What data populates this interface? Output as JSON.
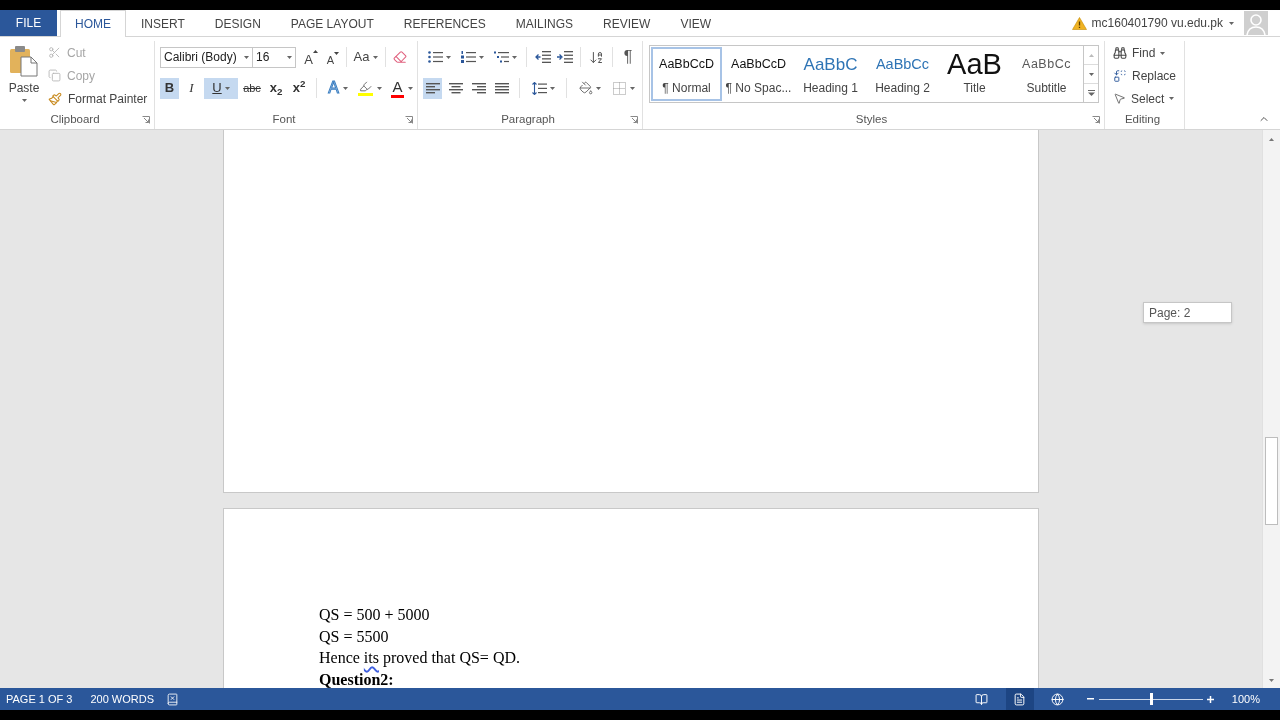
{
  "tabs": [
    {
      "label": "FILE",
      "kind": "file",
      "selected": false
    },
    {
      "label": "HOME",
      "kind": "tab",
      "selected": true
    },
    {
      "label": "INSERT",
      "kind": "tab",
      "selected": false
    },
    {
      "label": "DESIGN",
      "kind": "tab",
      "selected": false
    },
    {
      "label": "PAGE LAYOUT",
      "kind": "tab",
      "selected": false
    },
    {
      "label": "REFERENCES",
      "kind": "tab",
      "selected": false
    },
    {
      "label": "MAILINGS",
      "kind": "tab",
      "selected": false
    },
    {
      "label": "REVIEW",
      "kind": "tab",
      "selected": false
    },
    {
      "label": "VIEW",
      "kind": "tab",
      "selected": false
    }
  ],
  "account": {
    "name": "mc160401790 vu.edu.pk"
  },
  "clipboard": {
    "title": "Clipboard",
    "paste": "Paste",
    "commands": [
      {
        "label": "Cut",
        "kind": "cut",
        "disabled": true
      },
      {
        "label": "Copy",
        "kind": "copy",
        "disabled": true
      },
      {
        "label": "Format Painter",
        "kind": "painter",
        "disabled": false
      }
    ]
  },
  "font": {
    "title": "Font",
    "family": "Calibri (Body)",
    "size": "16",
    "grow": "A",
    "shrink": "A",
    "change_case": "Aa",
    "formats": [
      {
        "kind": "bold",
        "label": "B",
        "on": true
      },
      {
        "kind": "italic",
        "label": "I",
        "on": false
      },
      {
        "kind": "underline",
        "label": "U",
        "on": true
      },
      {
        "kind": "strikethrough",
        "label": "abc",
        "on": false
      },
      {
        "kind": "subscript",
        "label": "x$_{2}$",
        "on": false
      },
      {
        "kind": "superscript",
        "label": "x$^{2}$",
        "on": false
      }
    ],
    "text_effects": "A",
    "font_color": "A"
  },
  "paragraph": {
    "title": "Paragraph",
    "alignments": [
      {
        "kind": "left",
        "selected": true
      },
      {
        "kind": "center",
        "selected": false
      },
      {
        "kind": "right",
        "selected": false
      },
      {
        "kind": "justify",
        "selected": false
      }
    ],
    "show_marks": "¶"
  },
  "styles": {
    "title": "Styles",
    "gallery": [
      {
        "preview": "AaBbCcD",
        "name": "¶ Normal",
        "kind": "body",
        "selected": true
      },
      {
        "preview": "AaBbCcD",
        "name": "¶ No Spac...",
        "kind": "body",
        "selected": false
      },
      {
        "preview": "AaBbC",
        "name": "Heading 1",
        "kind": "heading1",
        "selected": false
      },
      {
        "preview": "AaBbCc",
        "name": "Heading 2",
        "kind": "heading2",
        "selected": false
      },
      {
        "preview": "AaB",
        "name": "Title",
        "kind": "title",
        "selected": false
      },
      {
        "preview": "AaBbCc",
        "name": "Subtitle",
        "kind": "subtitle",
        "selected": false
      }
    ]
  },
  "editing": {
    "title": "Editing",
    "commands": [
      {
        "label": "Find",
        "kind": "find"
      },
      {
        "label": "Replace",
        "kind": "replace"
      },
      {
        "label": "Select",
        "kind": "select"
      }
    ]
  },
  "document": {
    "tooltip": "Page: 2",
    "lines": [
      {
        "bold": false,
        "parts": [
          {
            "text": "QS = 500 + 5000",
            "flagged": false
          }
        ]
      },
      {
        "bold": false,
        "parts": [
          {
            "text": "QS = 5500",
            "flagged": false
          }
        ]
      },
      {
        "bold": false,
        "parts": [
          {
            "text": "Hence ",
            "flagged": false
          },
          {
            "text": "its",
            "flagged": true
          },
          {
            "text": " proved that QS= QD.",
            "flagged": false
          }
        ]
      },
      {
        "bold": true,
        "parts": [
          {
            "text": "Question2:",
            "flagged": false
          }
        ]
      }
    ]
  },
  "status_bar": {
    "page": "PAGE 1 OF 3",
    "words": "200 WORDS",
    "views": [
      {
        "kind": "read",
        "selected": false
      },
      {
        "kind": "print",
        "selected": true
      },
      {
        "kind": "web",
        "selected": false
      }
    ],
    "zoom": {
      "level": 0.5,
      "reading": "100%"
    }
  }
}
